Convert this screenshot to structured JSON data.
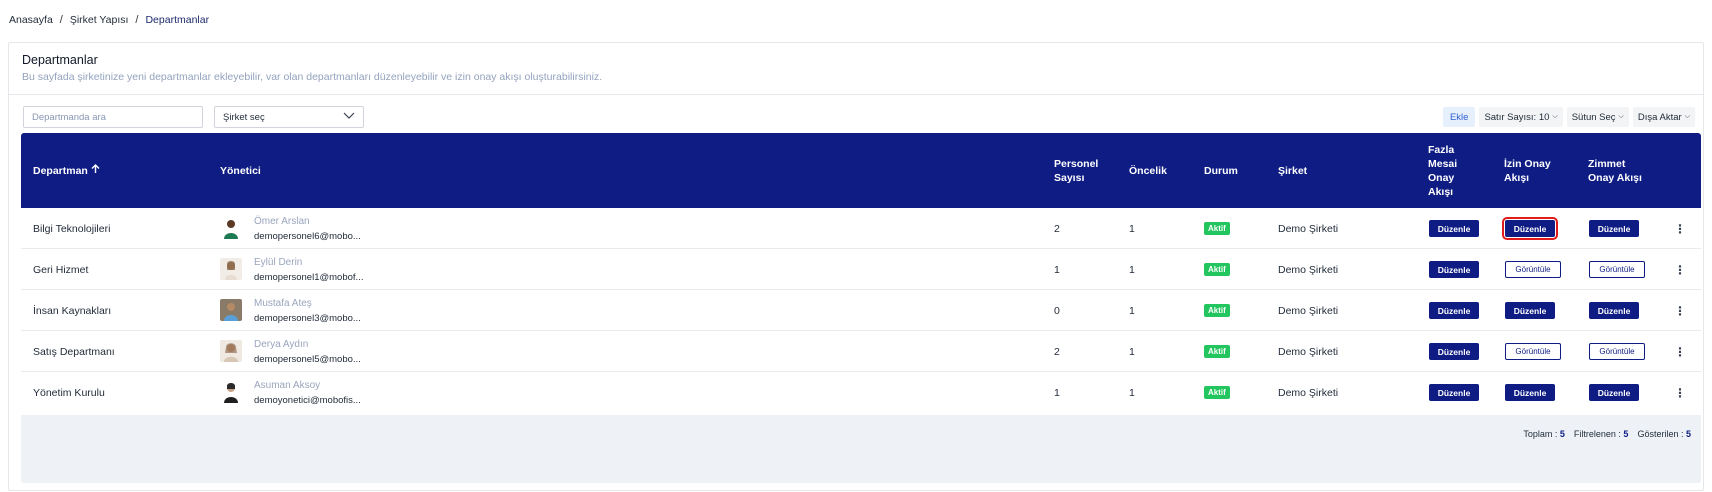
{
  "breadcrumb": {
    "home": "Anasayfa",
    "parent": "Şirket Yapısı",
    "current": "Departmanlar",
    "separator": "/"
  },
  "page": {
    "title": "Departmanlar",
    "subtitle": "Bu sayfada şirketinize yeni departmanlar ekleyebilir, var olan departmanları düzenleyebilir ve izin onay akışı oluşturabilirsiniz."
  },
  "filters": {
    "search_placeholder": "Departmanda ara",
    "company_select": "Şirket seç"
  },
  "toolbar": {
    "add": "Ekle",
    "rows": "Satır Sayısı: 10",
    "columns": "Sütun Seç",
    "export": "Dışa Aktar"
  },
  "columns": {
    "department": "Departman",
    "manager": "Yönetici",
    "staff_1": "Personel",
    "staff_2": "Sayısı",
    "priority": "Öncelik",
    "status": "Durum",
    "company": "Şirket",
    "overtime_1": "Fazla",
    "overtime_2": "Mesai",
    "overtime_3": "Onay",
    "overtime_4": "Akışı",
    "leave_1": "İzin Onay",
    "leave_2": "Akışı",
    "asset_1": "Zimmet",
    "asset_2": "Onay Akışı"
  },
  "rows": [
    {
      "department": "Bilgi Teknolojileri",
      "manager_name": "Ömer Arslan",
      "manager_email": "demopersonel6@mobo...",
      "staff": "2",
      "priority": "1",
      "status": "Aktif",
      "company": "Demo Şirketi",
      "overtime": "Düzenle",
      "leave": "Düzenle",
      "asset": "Düzenle"
    },
    {
      "department": "Geri Hizmet",
      "manager_name": "Eylül Derin",
      "manager_email": "demopersonel1@mobof...",
      "staff": "1",
      "priority": "1",
      "status": "Aktif",
      "company": "Demo Şirketi",
      "overtime": "Düzenle",
      "leave": "Görüntüle",
      "asset": "Görüntüle"
    },
    {
      "department": "İnsan Kaynakları",
      "manager_name": "Mustafa Ateş",
      "manager_email": "demopersonel3@mobo...",
      "staff": "0",
      "priority": "1",
      "status": "Aktif",
      "company": "Demo Şirketi",
      "overtime": "Düzenle",
      "leave": "Düzenle",
      "asset": "Düzenle"
    },
    {
      "department": "Satış Departmanı",
      "manager_name": "Derya Aydın",
      "manager_email": "demopersonel5@mobo...",
      "staff": "2",
      "priority": "1",
      "status": "Aktif",
      "company": "Demo Şirketi",
      "overtime": "Düzenle",
      "leave": "Görüntüle",
      "asset": "Görüntüle"
    },
    {
      "department": "Yönetim Kurulu",
      "manager_name": "Asuman Aksoy",
      "manager_email": "demoyonetici@mobofis...",
      "staff": "1",
      "priority": "1",
      "status": "Aktif",
      "company": "Demo Şirketi",
      "overtime": "Düzenle",
      "leave": "Düzenle",
      "asset": "Düzenle"
    }
  ],
  "footer": {
    "total_label": "Toplam :",
    "total": "5",
    "filtered_label": "Filtrelenen :",
    "filtered": "5",
    "shown_label": "Gösterilen :",
    "shown": "5"
  },
  "colors": {
    "header_bg": "#0e1c84",
    "badge_active": "#22c55e",
    "highlight": "#e01b1b"
  }
}
